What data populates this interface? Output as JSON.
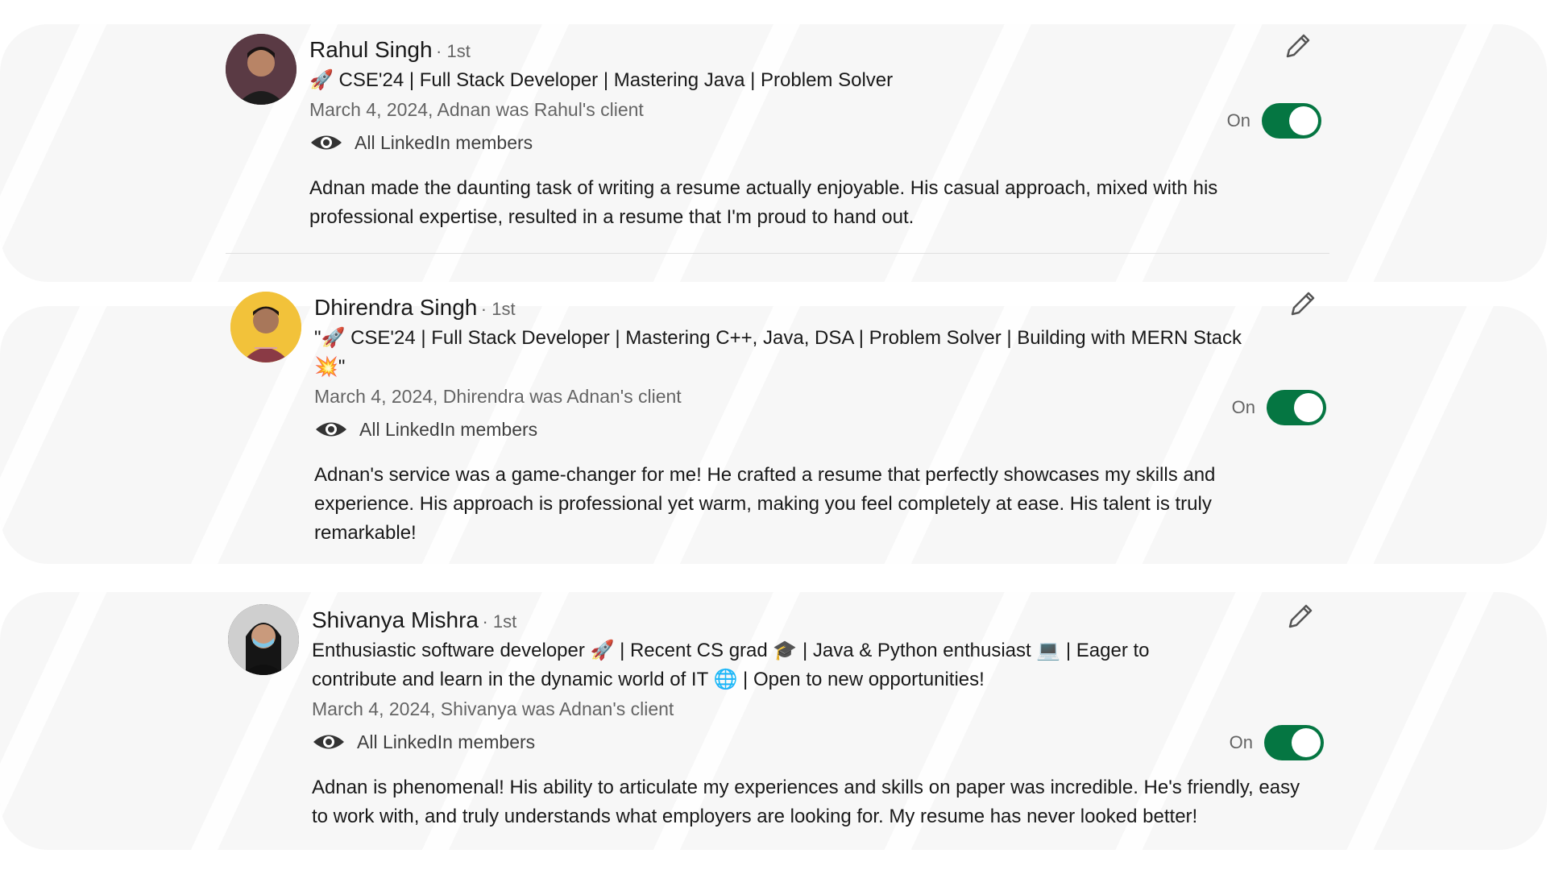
{
  "recommendations": [
    {
      "name": "Rahul Singh",
      "degree": "· 1st",
      "headline": "🚀 CSE'24 | Full Stack Developer | Mastering Java | Problem Solver",
      "date": "March 4, 2024, Adnan was Rahul's client",
      "visibility": "All LinkedIn members",
      "toggle_label": "On",
      "toggle_state": "on",
      "text": "Adnan made the daunting task of writing a resume actually enjoyable. His casual approach, mixed with his professional expertise, resulted in a resume that I'm proud to hand out."
    },
    {
      "name": "Dhirendra Singh",
      "degree": "· 1st",
      "headline": "\"🚀 CSE'24 | Full Stack Developer | Mastering C++, Java, DSA | Problem Solver | Building with MERN Stack 💥\"",
      "date": "March 4, 2024, Dhirendra was Adnan's client",
      "visibility": "All LinkedIn members",
      "toggle_label": "On",
      "toggle_state": "on",
      "text": "Adnan's service was a game-changer for me! He crafted a resume that perfectly showcases my skills and experience. His approach is professional yet warm, making you feel completely at ease. His talent is truly remarkable!"
    },
    {
      "name": "Shivanya Mishra",
      "degree": "· 1st",
      "headline": "Enthusiastic software developer 🚀 | Recent CS grad 🎓 | Java & Python enthusiast 💻 | Eager to contribute and learn in the dynamic world of IT 🌐 | Open to new opportunities!",
      "date": "March 4, 2024, Shivanya was Adnan's client",
      "visibility": "All LinkedIn members",
      "toggle_label": "On",
      "toggle_state": "on",
      "text": "Adnan is phenomenal! His ability to articulate my experiences and skills on paper was incredible. He's friendly, easy to work with, and truly understands what employers are looking for. My resume has never looked better!"
    }
  ],
  "colors": {
    "toggle_on": "#057642",
    "avatar_rahul_bg": "#3b2b2e",
    "avatar_dhirendra_bg": "#f2c23a",
    "avatar_shivanya_bg": "#2a2a2a"
  },
  "icons": {
    "edit": "pencil-icon",
    "visibility": "eye-icon"
  }
}
